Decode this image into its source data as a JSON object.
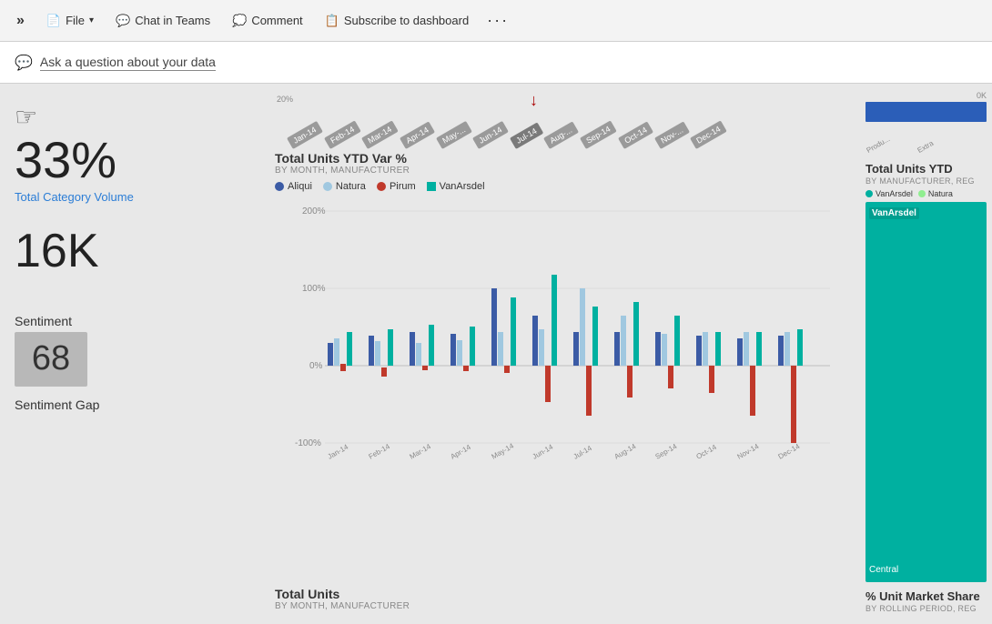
{
  "topbar": {
    "expand_icon": "»",
    "file_label": "File",
    "chat_label": "Chat in Teams",
    "comment_label": "Comment",
    "subscribe_label": "Subscribe to dashboard",
    "more_icon": "···"
  },
  "qabar": {
    "icon": "💬",
    "text": "Ask a question about your data"
  },
  "left": {
    "metric1_value": "33%",
    "metric1_label": "Total Category Volume",
    "metric2_value": "16K",
    "sentiment_label": "Sentiment",
    "sentiment_value": "68",
    "sentiment_gap_label": "Sentiment Gap"
  },
  "middle": {
    "ytd_title": "Total Units YTD Var %",
    "ytd_subtitle": "BY MONTH, MANUFACTURER",
    "months_top": [
      "Jan-14",
      "Feb-14",
      "Mar-14",
      "Apr-14",
      "May-...",
      "Jun-14",
      "Jul-14",
      "Aug-...",
      "Sep-14",
      "Oct-14",
      "Nov-...",
      "Dec-14"
    ],
    "legend": [
      {
        "label": "Aliqui",
        "color": "#3b5ba5"
      },
      {
        "label": "Natura",
        "color": "#a0c8e0"
      },
      {
        "label": "Pirum",
        "color": "#c0392b"
      },
      {
        "label": "VanArsdel",
        "color": "#00b0a0"
      }
    ],
    "y_labels": [
      "200%",
      "100%",
      "0%",
      "-100%"
    ],
    "x_labels": [
      "Jan-14",
      "Feb-14",
      "Mar-14",
      "Apr-14",
      "May-14",
      "Jun-14",
      "Jul-14",
      "Aug-14",
      "Sep-14",
      "Oct-14",
      "Nov-14",
      "Dec-14"
    ],
    "total_units_title": "Total Units",
    "total_units_subtitle": "BY MONTH, MANUFACTURER"
  },
  "right": {
    "ytd_title": "Total Units YTD",
    "ytd_subtitle": "BY MANUFACTURER, REG",
    "legend": [
      {
        "label": "VanArsdel",
        "color": "#00b0a0"
      },
      {
        "label": "Natura",
        "color": "#9fc"
      }
    ],
    "ok_label": "0K",
    "produ_label": "Produ...",
    "extra_label": "Extra",
    "vanarsdel_bar_label": "VanArsdel",
    "central_label": "Central",
    "unit_market_title": "% Unit Market Share",
    "unit_market_subtitle": "BY ROLLING PERIOD, REG"
  }
}
